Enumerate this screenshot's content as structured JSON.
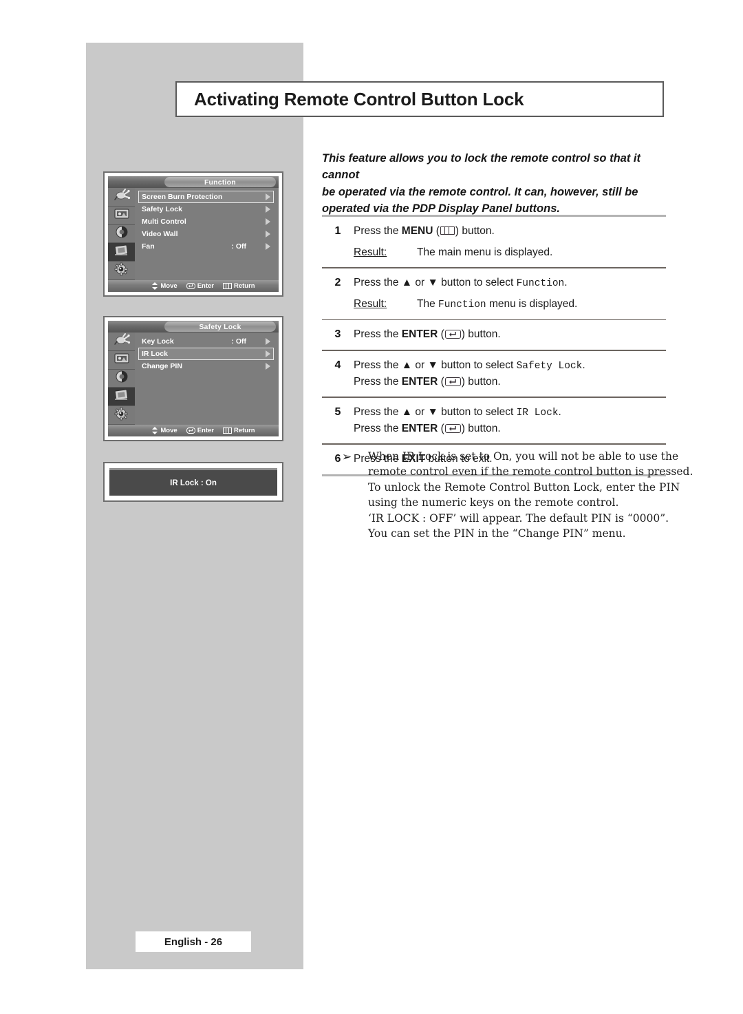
{
  "page": {
    "title": "Activating Remote Control Button Lock",
    "footer_label": "English - 26",
    "gray_panel_color": "#c9c9c9"
  },
  "intro": {
    "line1": "This feature allows you to lock the remote control so that it cannot",
    "line2": "be operated via the remote control. It can, however, still be",
    "line3": "operated via the PDP Display Panel buttons."
  },
  "steps": [
    {
      "num": "1",
      "pre": "Press the ",
      "key": "MENU",
      "icon": "menu-key-icon",
      "post": " button.",
      "result_label": "Result:",
      "result_pre": "The main menu is displayed.",
      "result_mono": "",
      "result_post": ""
    },
    {
      "num": "2",
      "pre": "Press the ▲ or ▼ button to select ",
      "mono": "Function",
      "post": ".",
      "result_label": "Result:",
      "result_pre": "The ",
      "result_mono": "Function",
      "result_post": " menu is displayed."
    },
    {
      "num": "3",
      "pre": "Press the ",
      "key": "ENTER",
      "icon": "enter-key-icon",
      "post": " button."
    },
    {
      "num": "4",
      "pre": "Press the ▲ or ▼ button to select ",
      "mono": "Safety Lock",
      "post": ".",
      "line2_pre": "Press the ",
      "line2_key": "ENTER",
      "line2_icon": "enter-key-icon",
      "line2_post": " button."
    },
    {
      "num": "5",
      "pre": "Press the ▲ or ▼ button to select ",
      "mono": "IR Lock",
      "post": ".",
      "line2_pre": "Press the ",
      "line2_key": "ENTER",
      "line2_icon": "enter-key-icon",
      "line2_post": " button."
    },
    {
      "num": "6",
      "pre": "Press the ",
      "key": "EXIT",
      "post": " button to exit."
    }
  ],
  "note": {
    "bullet": "➢",
    "lines": [
      "When IR Lock is set to On, you will not be able to use the",
      "remote control even if the remote control button is pressed.",
      "To unlock the Remote Control Button Lock, enter the PIN",
      "using the numeric keys on the remote control.",
      "‘IR LOCK : OFF’ will appear. The default PIN is “0000”.",
      "You can set the PIN in the “Change PIN” menu."
    ]
  },
  "osd_function": {
    "title": "Function",
    "rail_icons": [
      "input-source-icon",
      "picture-icon",
      "sound-icon",
      "function-chip-icon",
      "setup-gear-icon"
    ],
    "rail_active_index": 3,
    "rows": [
      {
        "label": "Screen Burn Protection",
        "value": "",
        "selected": true
      },
      {
        "label": "Safety Lock",
        "value": "",
        "selected": false
      },
      {
        "label": "Multi Control",
        "value": "",
        "selected": false
      },
      {
        "label": "Video Wall",
        "value": "",
        "selected": false
      },
      {
        "label": "Fan",
        "value": ": Off",
        "selected": false
      }
    ],
    "footer": [
      {
        "icon": "move-updown-icon",
        "label": "Move"
      },
      {
        "icon": "enter-key-icon",
        "label": "Enter"
      },
      {
        "icon": "menu-key-icon",
        "label": "Return"
      }
    ]
  },
  "osd_safety_lock": {
    "title": "Safety Lock",
    "rail_icons": [
      "input-source-icon",
      "picture-icon",
      "sound-icon",
      "function-chip-icon",
      "setup-gear-icon"
    ],
    "rail_active_index": 3,
    "rows": [
      {
        "label": "Key Lock",
        "value": ": Off",
        "selected": false
      },
      {
        "label": "IR Lock",
        "value": "",
        "selected": true
      },
      {
        "label": "Change PIN",
        "value": "",
        "selected": false
      }
    ],
    "footer": [
      {
        "icon": "move-updown-icon",
        "label": "Move"
      },
      {
        "icon": "enter-key-icon",
        "label": "Enter"
      },
      {
        "icon": "menu-key-icon",
        "label": "Return"
      }
    ]
  },
  "toast": {
    "text": "IR Lock : On"
  }
}
